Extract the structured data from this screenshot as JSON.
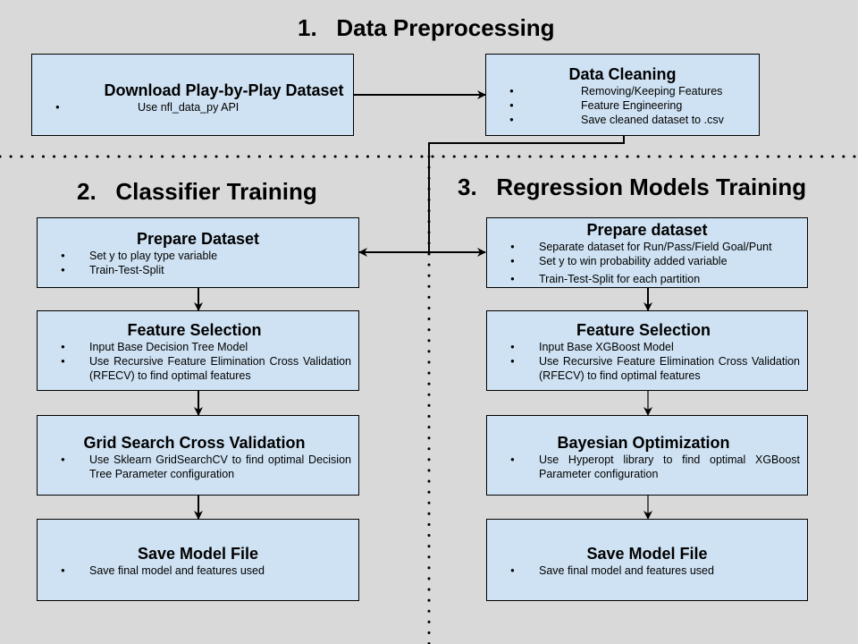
{
  "sections": {
    "preprocessing": "1.   Data Preprocessing",
    "classifier": "2.   Classifier Training",
    "regression": "3.   Regression Models Training"
  },
  "boxes": {
    "download": {
      "title": "Download Play-by-Play Dataset",
      "items": [
        "Use nfl_data_py API"
      ]
    },
    "cleaning": {
      "title": "Data Cleaning",
      "items": [
        "Removing/Keeping Features",
        "Feature Engineering",
        "Save cleaned dataset to .csv"
      ]
    },
    "c_prepare": {
      "title": "Prepare Dataset",
      "items": [
        "Set y to play type variable",
        "Train-Test-Split"
      ]
    },
    "c_feature": {
      "title": "Feature Selection",
      "items": [
        "Input Base Decision Tree Model",
        "Use Recursive Feature Elimination Cross Validation (RFECV) to find optimal features"
      ]
    },
    "c_grid": {
      "title": "Grid Search Cross Validation",
      "items": [
        "Use Sklearn GridSearchCV to find optimal Decision Tree Parameter configuration"
      ]
    },
    "c_save": {
      "title": "Save Model File",
      "items": [
        "Save final model and features used"
      ]
    },
    "r_prepare": {
      "title": "Prepare dataset",
      "items": [
        "Separate dataset for Run/Pass/Field Goal/Punt",
        "Set y to win probability added variable",
        "Train-Test-Split for each partition"
      ]
    },
    "r_feature": {
      "title": "Feature Selection",
      "items": [
        "Input Base XGBoost Model",
        "Use Recursive Feature Elimination Cross Validation (RFECV) to find optimal features"
      ]
    },
    "r_bayes": {
      "title": "Bayesian Optimization",
      "items": [
        "Use Hyperopt library to find optimal XGBoost Parameter configuration"
      ]
    },
    "r_save": {
      "title": "Save Model File",
      "items": [
        "Save final model and features used"
      ]
    }
  }
}
